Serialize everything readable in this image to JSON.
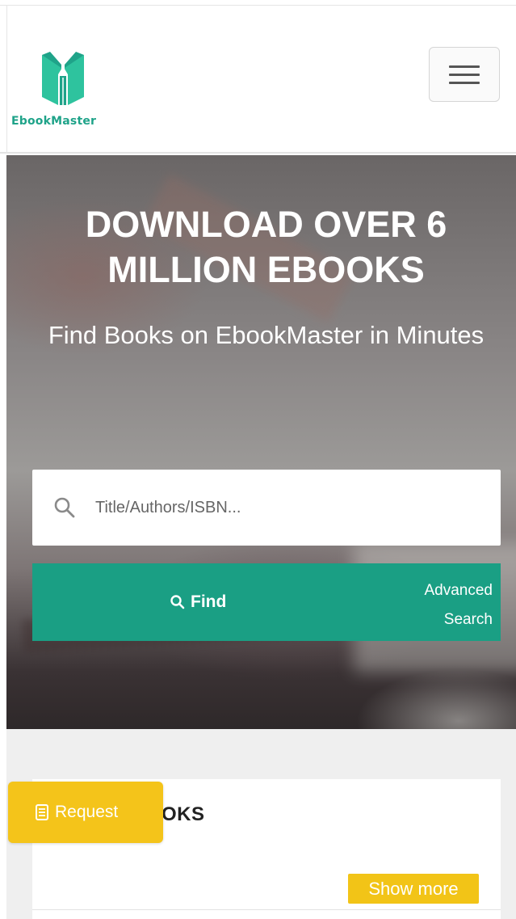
{
  "header": {
    "logo_text": "EbookMaster",
    "logo_icon": "open-book-pencil-icon",
    "menu_icon": "hamburger-icon"
  },
  "hero": {
    "title": "DOWNLOAD OVER 6 MILLION EBOOKS",
    "subtitle": "Find Books on EbookMaster in Minutes"
  },
  "search": {
    "icon": "search-icon",
    "placeholder": "Title/Authors/ISBN...",
    "value": ""
  },
  "actions": {
    "find_label": "Find",
    "advanced_label_line1": "Advanced",
    "advanced_label_line2": "Search"
  },
  "section": {
    "title_visible_fragment": "OKS",
    "show_more_label": "Show more"
  },
  "floating": {
    "request_label": "Request",
    "request_icon": "document-icon"
  },
  "colors": {
    "brand_green": "#1a9f84",
    "accent_yellow": "#f2c417",
    "header_bg": "#ffffff",
    "section_bg": "#efefef"
  }
}
